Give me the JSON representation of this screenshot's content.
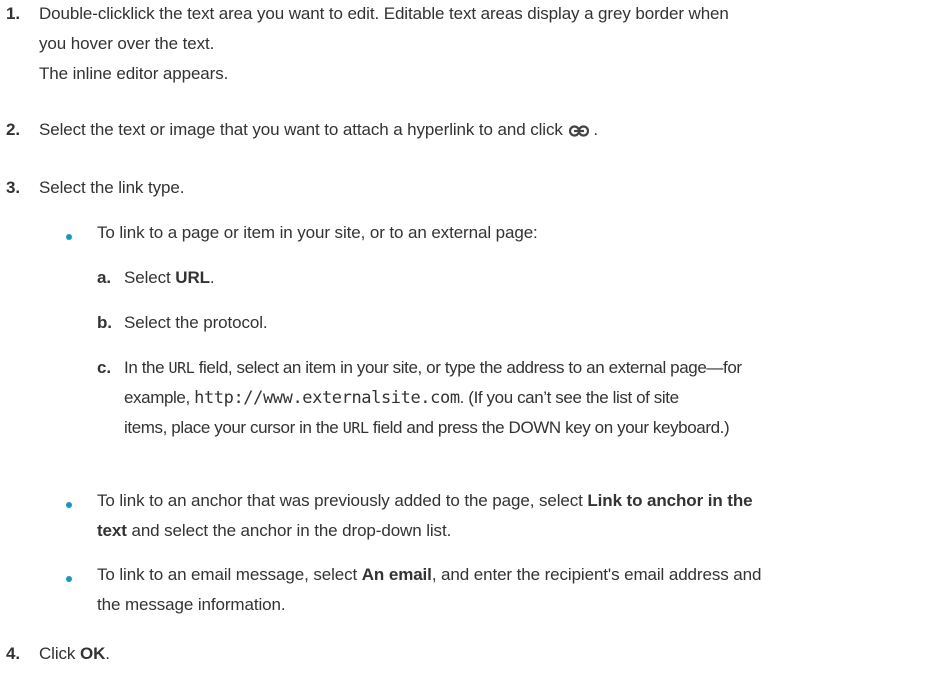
{
  "steps": [
    {
      "num": "1.",
      "line1": "Double-clicklick the text area you want to edit. Editable text areas display a grey border when",
      "line2": "you hover over the text.",
      "line3": "The inline editor appears."
    },
    {
      "num": "2.",
      "text": "Select the text or image that you want to attach a hyperlink to and click",
      "tail": ".",
      "icon": "link-icon"
    },
    {
      "num": "3.",
      "text": "Select the link type.",
      "bullets": [
        {
          "text": "To link to a page or item in your site, or to an external page:",
          "substeps": [
            {
              "label": "a.",
              "pre": "Select ",
              "bold": "URL",
              "post": "."
            },
            {
              "label": "b.",
              "text": "Select the protocol."
            },
            {
              "label": "c.",
              "p1": "In the ",
              "code1": "URL",
              "p2": " field, select an item in your site, or type the address to an external page—for",
              "p3": "example, ",
              "code2": "http://www.externalsite.com",
              "p4": ". (If you can’t see the list of site",
              "p5": "items, place your cursor in the ",
              "code3": "URL",
              "p6": " field and press the DOWN key on your keyboard.)"
            }
          ]
        },
        {
          "pre": "To link to an anchor that was previously added to the page, select ",
          "bold1": "Link to anchor in the",
          "bold2": "text",
          "post": " and select the anchor in the drop-down list."
        },
        {
          "pre": "To link to an email message, select ",
          "bold": "An email",
          "post": ", and enter the recipient's email address and",
          "line2": "the message information."
        }
      ]
    },
    {
      "num": "4.",
      "pre": "Click ",
      "bold": "OK",
      "post": "."
    }
  ],
  "colors": {
    "bullet": "#1798c1",
    "text": "#333333"
  }
}
